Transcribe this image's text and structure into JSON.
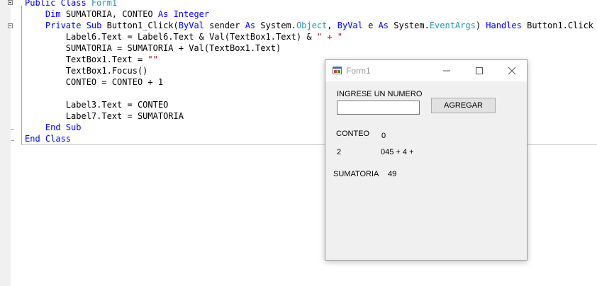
{
  "editor": {
    "lines": [
      [
        {
          "t": "Public Class ",
          "c": "kw"
        },
        {
          "t": "Form1",
          "c": "ty"
        }
      ],
      [
        {
          "t": "    "
        },
        {
          "t": "Dim",
          "c": "kw"
        },
        {
          "t": " SUMATORIA, CONTEO "
        },
        {
          "t": "As",
          "c": "kw"
        },
        {
          "t": " "
        },
        {
          "t": "Integer",
          "c": "kw"
        }
      ],
      [
        {
          "t": "    "
        },
        {
          "t": "Private Sub",
          "c": "kw"
        },
        {
          "t": " Button1_Click("
        },
        {
          "t": "ByVal",
          "c": "kw"
        },
        {
          "t": " sender "
        },
        {
          "t": "As",
          "c": "kw"
        },
        {
          "t": " System."
        },
        {
          "t": "Object",
          "c": "ty"
        },
        {
          "t": ", "
        },
        {
          "t": "ByVal",
          "c": "kw"
        },
        {
          "t": " e "
        },
        {
          "t": "As",
          "c": "kw"
        },
        {
          "t": " System."
        },
        {
          "t": "EventArgs",
          "c": "ty"
        },
        {
          "t": ") "
        },
        {
          "t": "Handles",
          "c": "kw"
        },
        {
          "t": " Button1.Click"
        }
      ],
      [
        {
          "t": "        Label6.Text = Label6.Text & Val(TextBox1.Text) & "
        },
        {
          "t": "\" + \"",
          "c": "st"
        }
      ],
      [
        {
          "t": "        SUMATORIA = SUMATORIA + Val(TextBox1.Text)"
        }
      ],
      [
        {
          "t": "        TextBox1.Text = "
        },
        {
          "t": "\"\"",
          "c": "st"
        }
      ],
      [
        {
          "t": "        TextBox1.Focus()"
        }
      ],
      [
        {
          "t": "        CONTEO = CONTEO + 1"
        }
      ],
      [
        {
          "t": ""
        }
      ],
      [
        {
          "t": "        Label3.Text = CONTEO"
        }
      ],
      [
        {
          "t": "        Label7.Text = SUMATORIA"
        }
      ],
      [
        {
          "t": "    "
        },
        {
          "t": "End Sub",
          "c": "kw"
        }
      ],
      [
        {
          "t": "End Class",
          "c": "kw"
        }
      ]
    ]
  },
  "form": {
    "title": "Form1",
    "prompt_label": "INGRESE UN NUMERO",
    "input_value": "",
    "add_button": "AGREGAR",
    "conteo_label": "CONTEO",
    "conteo_value": "0",
    "count_value": "2",
    "list_value": "045 + 4 +",
    "sum_label": "SUMATORIA",
    "sum_value": "49"
  },
  "icons": {
    "app": "form-app-icon",
    "minimize": "minimize-icon",
    "maximize": "maximize-icon",
    "close": "close-icon"
  },
  "colors": {
    "keyword": "#0000ff",
    "type": "#2b91af",
    "string": "#a31515"
  }
}
